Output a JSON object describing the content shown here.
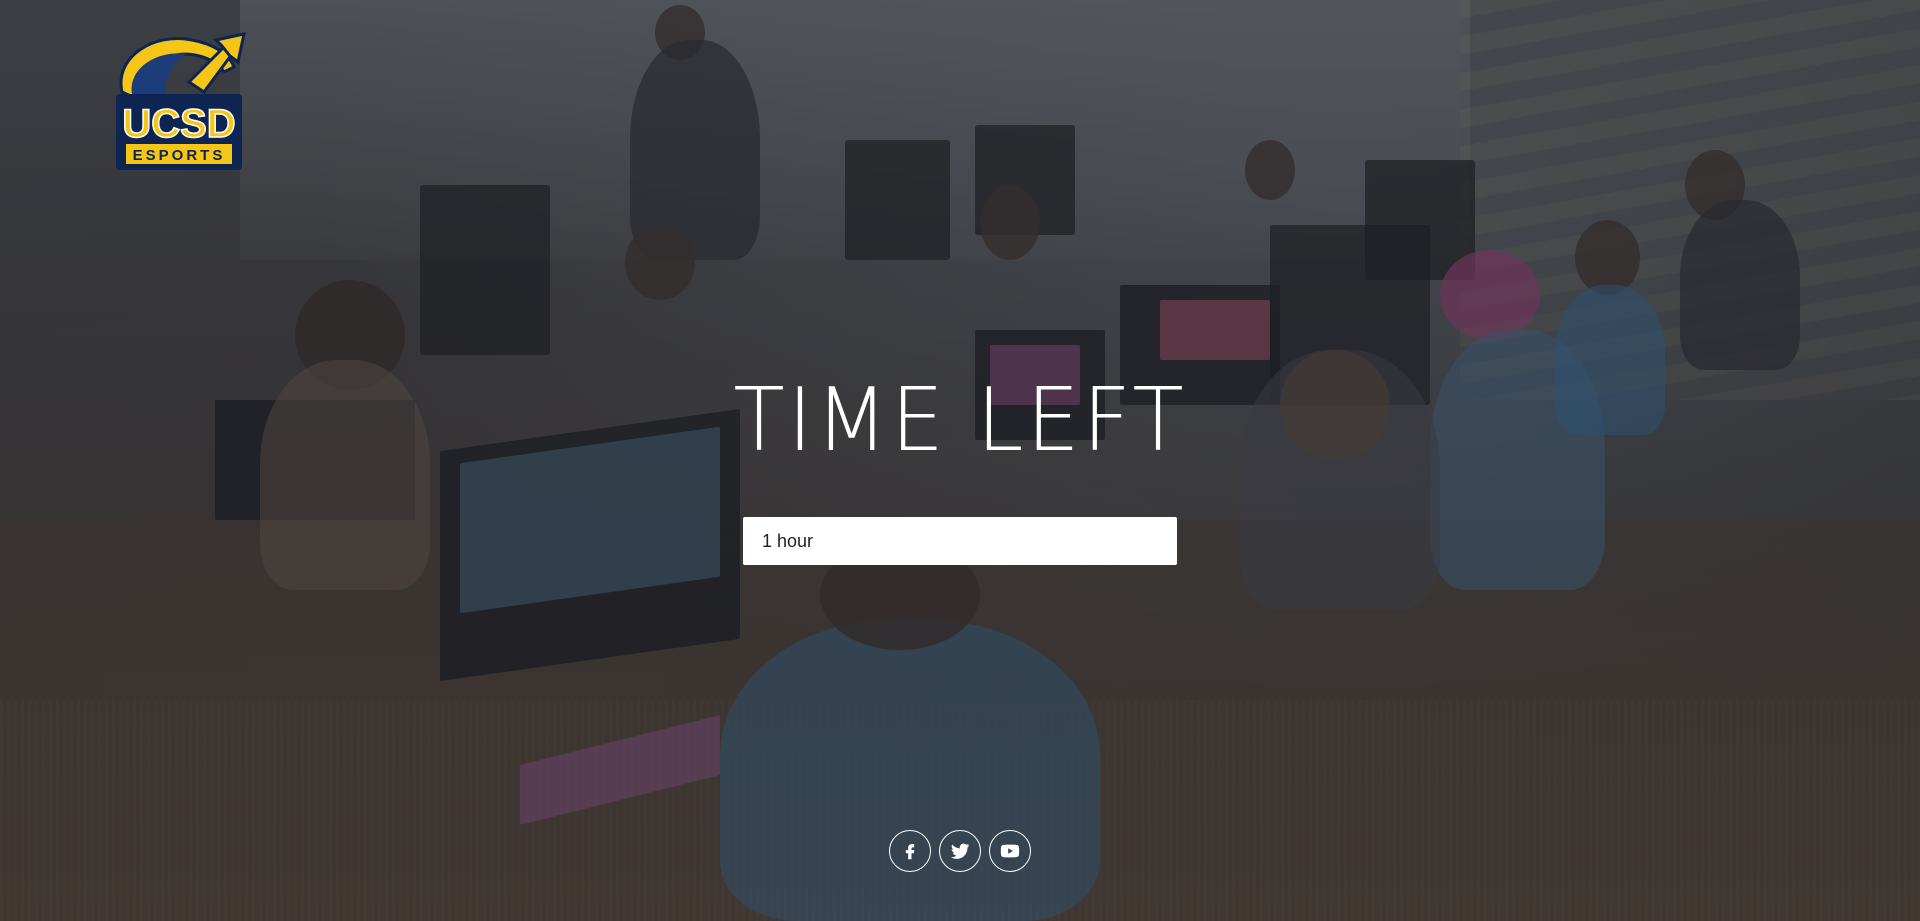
{
  "logo": {
    "line1": "UCSD",
    "line2": "ESPORTS",
    "primary_color": "#f5c518",
    "secondary_color": "#1d3d7a"
  },
  "hero": {
    "title": "TIME LEFT",
    "time_value": "1 hour"
  },
  "social": {
    "icons": [
      "facebook-icon",
      "twitter-icon",
      "youtube-icon"
    ]
  },
  "colors": {
    "text": "#ffffff",
    "field_background": "#ffffff"
  }
}
